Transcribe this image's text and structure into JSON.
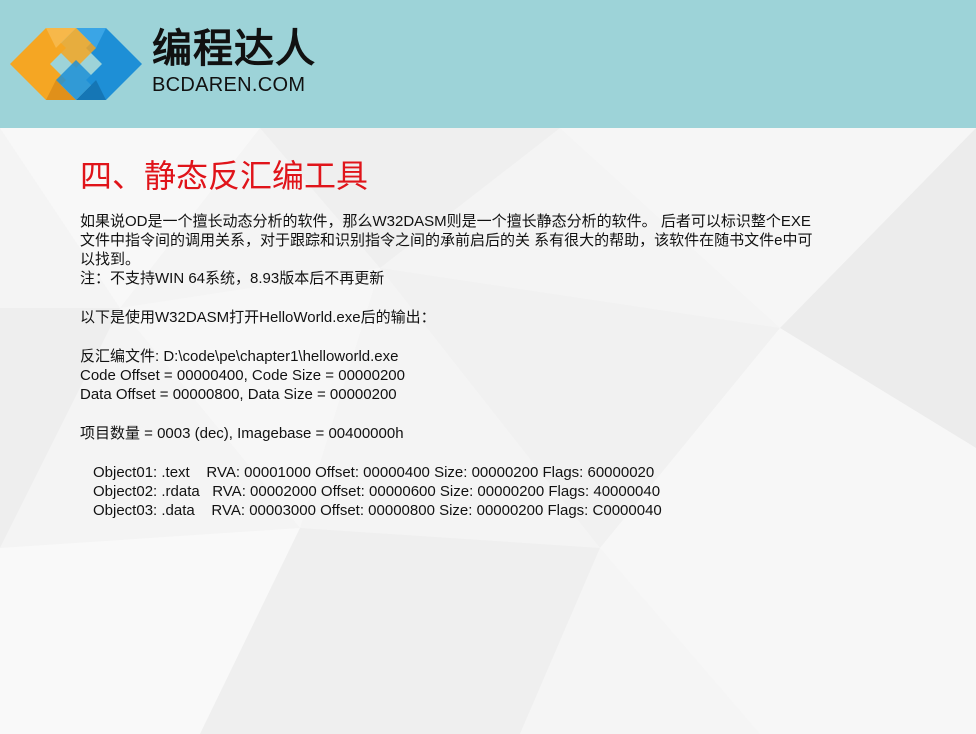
{
  "header": {
    "brand_cn": "编程达人",
    "brand_en": "BCDAREN.COM"
  },
  "slide": {
    "title": "四、静态反汇编工具",
    "intro": "如果说OD是一个擅长动态分析的软件，那么W32DASM则是一个擅长静态分析的软件。 后者可以标识整个EXE\n文件中指令间的调用关系，对于跟踪和识别指令之间的承前启后的关 系有很大的帮助，该软件在随书文件e中可\n以找到。",
    "note": "注：不支持WIN 64系统，8.93版本后不再更新",
    "output_intro": "以下是使用W32DASM打开HelloWorld.exe后的输出：",
    "disasm_file": "反汇编文件: D:\\code\\pe\\chapter1\\helloworld.exe",
    "code_line": "Code Offset = 00000400, Code Size = 00000200",
    "data_line": "Data Offset = 00000800, Data Size = 00000200",
    "item_count": "项目数量 = 0003 (dec), Imagebase = 00400000h",
    "objects": [
      "Object01: .text    RVA: 00001000 Offset: 00000400 Size: 00000200 Flags: 60000020",
      "Object02: .rdata   RVA: 00002000 Offset: 00000600 Size: 00000200 Flags: 40000040",
      "Object03: .data    RVA: 00003000 Offset: 00000800 Size: 00000200 Flags: C0000040"
    ]
  },
  "colors": {
    "header_bg": "#9dd3d8",
    "title": "#e0141a",
    "logo_orange": "#f5a623",
    "logo_blue": "#1e8fd6"
  }
}
